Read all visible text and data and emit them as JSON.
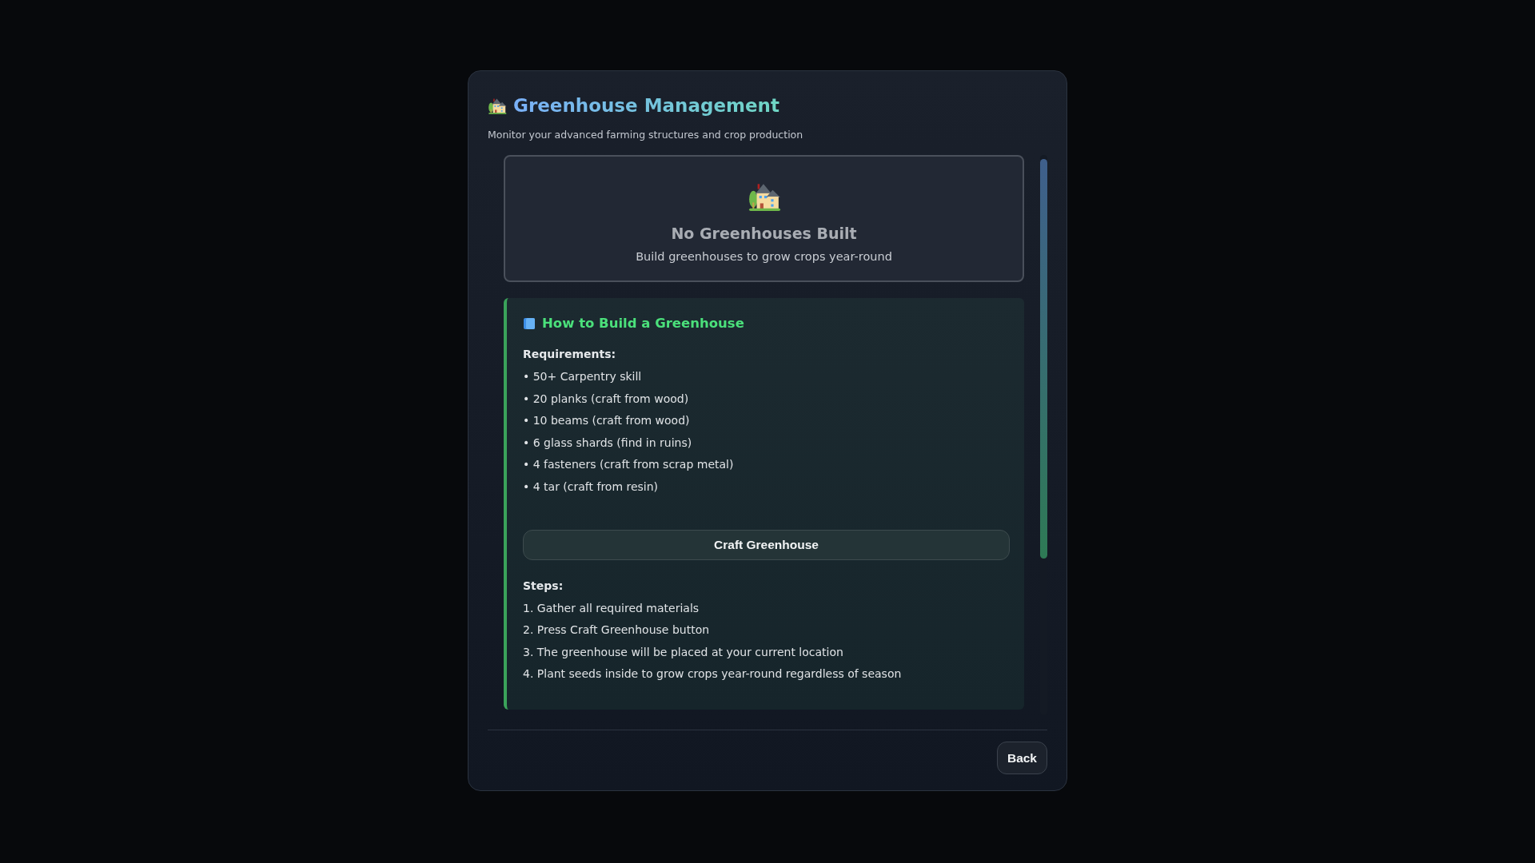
{
  "modal": {
    "title": "Greenhouse Management",
    "subtitle": "Monitor your advanced farming structures and crop production",
    "empty_state": {
      "title": "No Greenhouses Built",
      "text": "Build greenhouses to grow crops year-round"
    },
    "guide": {
      "title": "How to Build a Greenhouse",
      "requirements_label": "Requirements:",
      "requirements": [
        "• 50+ Carpentry skill",
        "• 20 planks (craft from wood)",
        "• 10 beams (craft from wood)",
        "• 6 glass shards (find in ruins)",
        "• 4 fasteners (craft from scrap metal)",
        "• 4 tar (craft from resin)"
      ],
      "craft_button": "Craft Greenhouse",
      "steps_label": "Steps:",
      "steps": [
        "1. Gather all required materials",
        "2. Press Craft Greenhouse button",
        "3. The greenhouse will be placed at your current location",
        "4. Plant seeds inside to grow crops year-round regardless of season"
      ]
    },
    "buttons": [
      "Back"
    ]
  }
}
